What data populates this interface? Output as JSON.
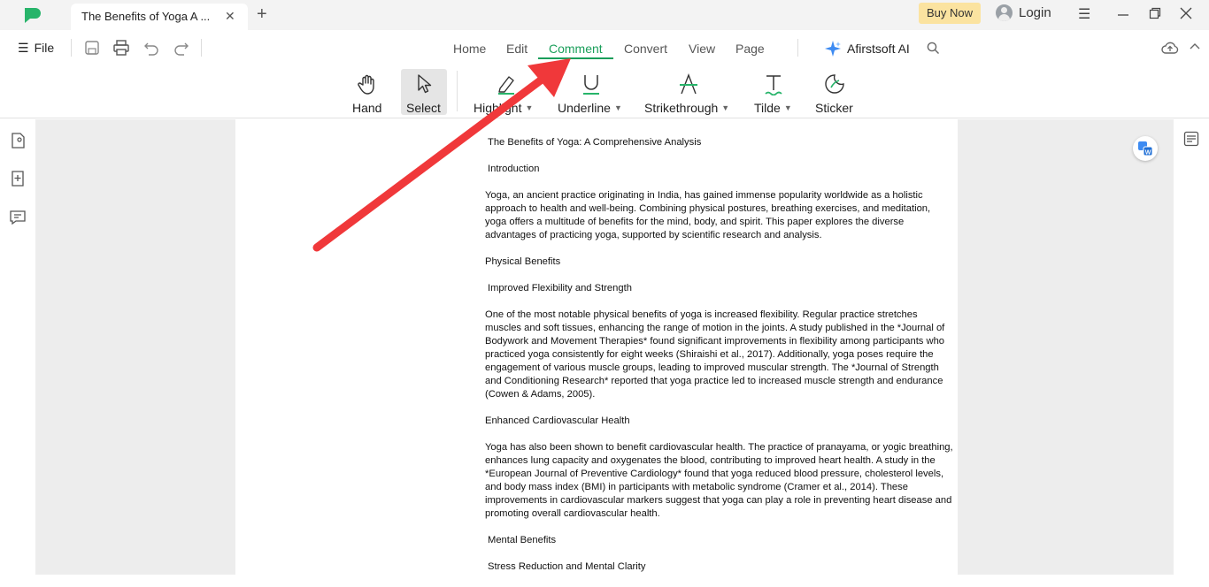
{
  "window": {
    "tab_title": "The Benefits of Yoga A ...",
    "buy_now": "Buy Now",
    "login": "Login"
  },
  "menubar": {
    "file_label": "File",
    "tabs": [
      "Home",
      "Edit",
      "Comment",
      "Convert",
      "View",
      "Page"
    ],
    "active_tab": "Comment",
    "ai_label": "Afirstsoft AI"
  },
  "toolbar": {
    "tools": [
      {
        "label": "Hand"
      },
      {
        "label": "Select"
      },
      {
        "label": "Highlight"
      },
      {
        "label": "Underline"
      },
      {
        "label": "Strikethrough"
      },
      {
        "label": "Tilde"
      },
      {
        "label": "Sticker"
      }
    ],
    "selected_tool": "Select"
  },
  "document": {
    "title": "The Benefits of Yoga: A Comprehensive Analysis",
    "intro_heading": "Introduction",
    "intro_text": "Yoga, an ancient practice originating in India, has gained immense popularity worldwide as a holistic approach to health and well-being. Combining physical postures, breathing exercises, and meditation, yoga offers a multitude of benefits for the mind, body, and spirit. This paper explores the diverse advantages of practicing yoga, supported by scientific research and analysis.",
    "physical_heading": "Physical Benefits",
    "flex_heading": "Improved Flexibility and Strength",
    "flex_text": "One of the most notable physical benefits of yoga is increased flexibility. Regular practice stretches muscles and soft tissues, enhancing the range of motion in the joints. A study published in the *Journal of Bodywork and Movement Therapies* found significant improvements in flexibility among participants who practiced yoga consistently for eight weeks (Shiraishi et al., 2017). Additionally, yoga poses require the engagement of various muscle groups, leading to improved muscular strength. The *Journal of Strength and Conditioning Research* reported that yoga practice led to increased muscle strength and endurance (Cowen & Adams, 2005).",
    "cardio_heading": "Enhanced Cardiovascular Health",
    "cardio_text": "Yoga has also been shown to benefit cardiovascular health. The practice of pranayama, or yogic breathing, enhances lung capacity and oxygenates the blood, contributing to improved heart health. A study in the *European Journal of Preventive Cardiology* found that yoga reduced blood pressure, cholesterol levels, and body mass index (BMI) in participants with metabolic syndrome (Cramer et al., 2014). These improvements in cardiovascular markers suggest that yoga can play a role in preventing heart disease and promoting overall cardiovascular health.",
    "mental_heading": "Mental Benefits",
    "stress_heading": "Stress Reduction and Mental Clarity"
  },
  "colors": {
    "accent_green": "#1a9e5a",
    "annotation_arrow": "#f0383a",
    "buy_now_bg": "#fbe3a0"
  }
}
